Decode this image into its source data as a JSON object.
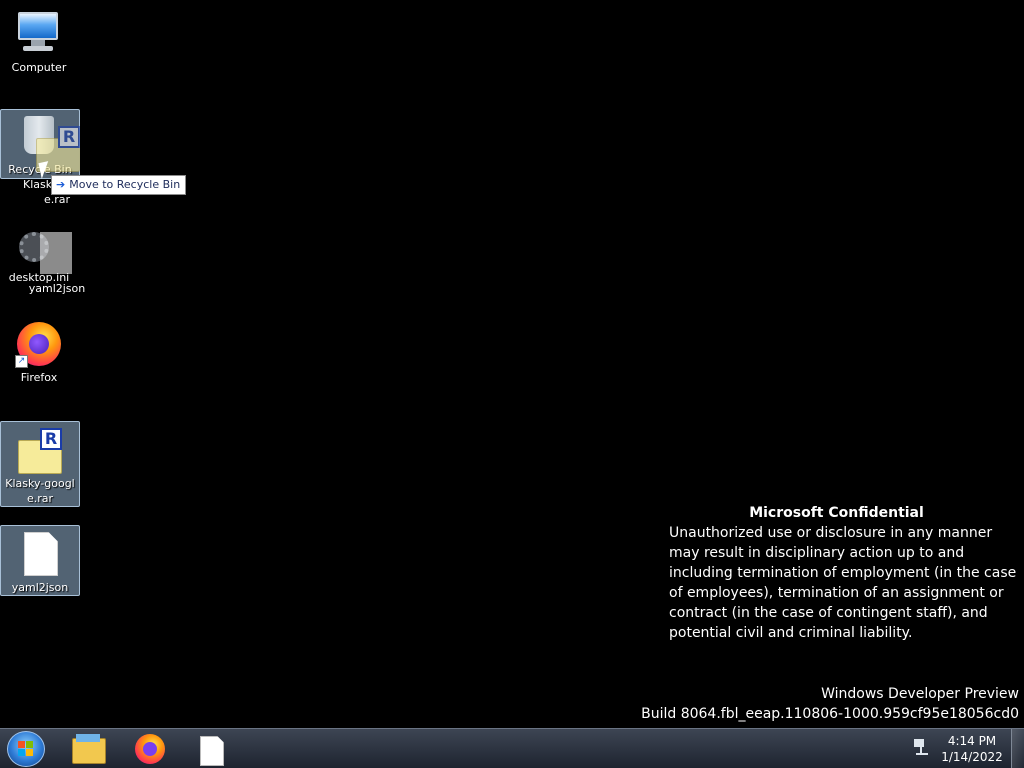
{
  "desktop": {
    "icons": [
      {
        "label": "Computer",
        "icon": "computer-icon"
      },
      {
        "label": "Recycle Bin",
        "icon": "recycle-bin-icon"
      },
      {
        "label": "desktop.ini",
        "icon": "settings-file-icon"
      },
      {
        "label": "Firefox",
        "icon": "firefox-icon"
      },
      {
        "label": "Klasky-googl e.rar",
        "icon": "rar-archive-icon"
      },
      {
        "label": "yaml2json",
        "icon": "blank-file-icon"
      }
    ],
    "drag_ghost": {
      "rar_label": "e.rar",
      "rar_label_partial": "Klask",
      "file_label": "yaml2json"
    },
    "drag_tooltip": "Move to Recycle Bin"
  },
  "watermark": {
    "title": "Microsoft Confidential",
    "body": "Unauthorized use or disclosure in any manner may result in disciplinary action up to and including termination of employment (in the case of employees), termination of an assignment or contract (in the case of contingent staff), and potential civil and criminal liability.",
    "edition": "Windows Developer Preview",
    "build": "Build 8064.fbl_eeap.110806-1000.959cf95e18056cd0"
  },
  "taskbar": {
    "start_icon": "windows-logo-icon",
    "pinned": [
      {
        "name": "File Explorer",
        "icon": "folder-icon"
      },
      {
        "name": "Firefox",
        "icon": "firefox-icon"
      },
      {
        "name": "yaml2json",
        "icon": "blank-file-icon"
      }
    ],
    "tray": {
      "network_icon": "network-icon",
      "time": "4:14 PM",
      "date": "1/14/2022"
    }
  },
  "colors": {
    "desktop_bg": "#000000",
    "selection": "#96b4d2",
    "taskbar": "#2a313d"
  }
}
